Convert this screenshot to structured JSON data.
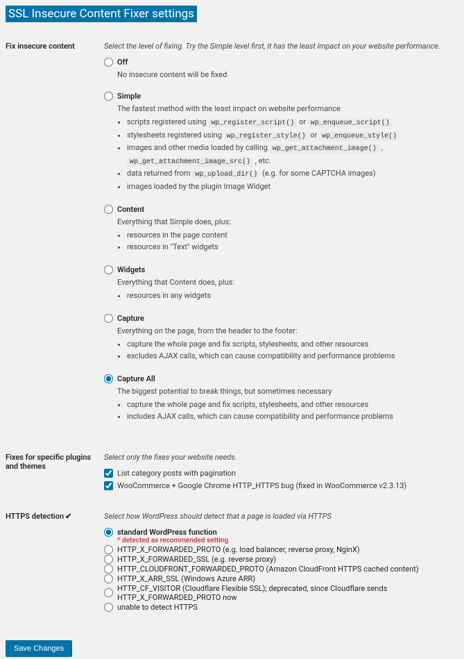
{
  "title": "SSL Insecure Content Fixer settings",
  "fix": {
    "label": "Fix insecure content",
    "desc": "Select the level of fixing. Try the Simple level first, it has the least impact on your website performance.",
    "options": {
      "off": {
        "label": "Off",
        "desc": "No insecure content will be fixed"
      },
      "simple": {
        "label": "Simple",
        "desc": "The fastest method with the least impact on website performance",
        "b1a": "scripts registered using ",
        "b1c1": "wp_register_script()",
        "b1b": " or ",
        "b1c2": "wp_enqueue_script()",
        "b2a": "stylesheets registered using ",
        "b2c1": "wp_register_style()",
        "b2b": " or ",
        "b2c2": "wp_enqueue_style()",
        "b3a": "images and other media loaded by calling ",
        "b3c1": "wp_get_attachment_image()",
        "b3b": " , ",
        "b3c2": "wp_get_attachment_image_src()",
        "b3c": " , etc.",
        "b4a": "data returned from ",
        "b4c1": "wp_upload_dir()",
        "b4b": " (e.g. for some CAPTCHA images)",
        "b5": "images loaded by the plugin Image Widget"
      },
      "content": {
        "label": "Content",
        "desc": "Everything that Simple does, plus:",
        "b1": "resources in the page content",
        "b2": "resources in \"Text\" widgets"
      },
      "widgets": {
        "label": "Widgets",
        "desc": "Everything that Content does, plus:",
        "b1": "resources in any widgets"
      },
      "capture": {
        "label": "Capture",
        "desc": "Everything on the page, from the header to the footer:",
        "b1": "capture the whole page and fix scripts, stylesheets, and other resources",
        "b2": "excludes AJAX calls, which can cause compatibility and performance problems"
      },
      "capture_all": {
        "label": "Capture All",
        "desc": "The biggest potential to break things, but sometimes necessary",
        "b1": "capture the whole page and fix scripts, stylesheets, and other resources",
        "b2": "includes AJAX calls, which can cause compatibility and performance problems"
      }
    }
  },
  "plugins": {
    "label": "Fixes for specific plugins and themes",
    "desc": "Select only the fixes your website needs.",
    "c1": "List category posts with pagination",
    "c2": "WooCommerce + Google Chrome HTTP_HTTPS bug (fixed in WooCommerce v2.3.13)"
  },
  "https": {
    "label": "HTTPS detection",
    "desc": "Select how WordPress should detect that a page is loaded via HTTPS",
    "o1": "standard WordPress function",
    "rec": "* detected as recommended setting",
    "o2": "HTTP_X_FORWARDED_PROTO (e.g. load balancer, reverse proxy, NginX)",
    "o3": "HTTP_X_FORWARDED_SSL (e.g. reverse proxy)",
    "o4": "HTTP_CLOUDFRONT_FORWARDED_PROTO (Amazon CloudFront HTTPS cached content)",
    "o5": "HTTP_X_ARR_SSL (Windows Azure ARR)",
    "o6": "HTTP_CF_VISITOR (Cloudflare Flexible SSL); deprecated, since Cloudflare sends HTTP_X_FORWARDED_PROTO now",
    "o7": "unable to detect HTTPS"
  },
  "save": "Save Changes"
}
